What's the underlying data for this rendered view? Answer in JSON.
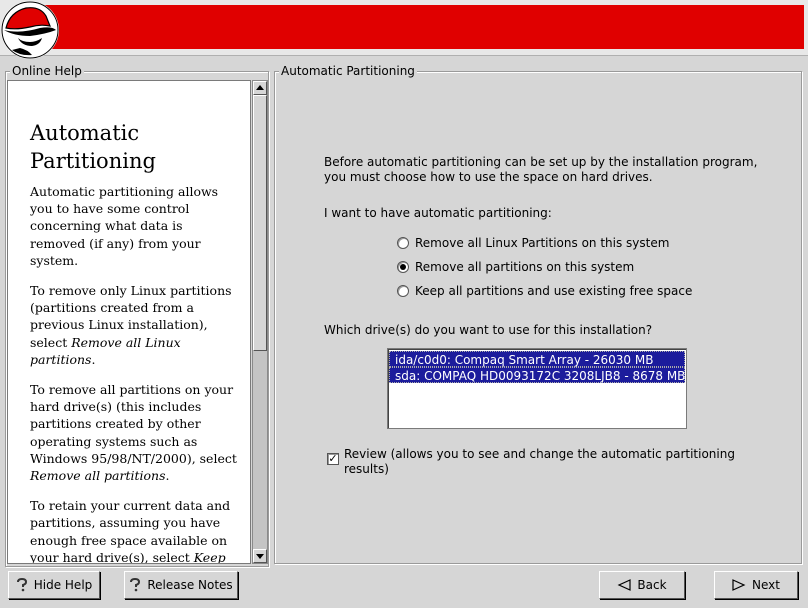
{
  "help_panel": {
    "title": "Online Help",
    "heading": "Automatic Partitioning",
    "paragraphs": [
      {
        "text": "Automatic partitioning allows you to have some control concerning what data is removed (if any) from your system.",
        "em": ""
      },
      {
        "text": "To remove only Linux partitions (partitions created from a previous Linux installation), select ",
        "em": "Remove all Linux partitions",
        "tail": "."
      },
      {
        "text": "To remove all partitions on your hard drive(s) (this includes partitions created by other operating systems such as Windows 95/98/NT/2000), select ",
        "em": "Remove all partitions",
        "tail": "."
      },
      {
        "text": "To retain your current data and partitions, assuming you have enough free space available on your hard drive(s), select ",
        "em": "Keep all partitions and use existing free space",
        "tail": "."
      }
    ]
  },
  "main": {
    "title": "Automatic Partitioning",
    "intro_line1": "Before automatic partitioning can be set up by the installation program,",
    "intro_line2": "you must choose how to use the space on hard drives.",
    "want_label": "I want to have automatic partitioning:",
    "options": [
      {
        "label": "Remove all Linux Partitions on this system",
        "checked": false
      },
      {
        "label": "Remove all partitions on this system",
        "checked": true
      },
      {
        "label": "Keep all partitions and use existing free space",
        "checked": false
      }
    ],
    "drives_label": "Which drive(s) do you want to use for this installation?",
    "drives": [
      "ida/c0d0: Compaq Smart Array - 26030 MB",
      "sda: COMPAQ HD0093172C 3208LJB8 - 8678 MB"
    ],
    "review_line1": "Review (allows you to see and change the automatic partitioning",
    "review_line2": "results)",
    "review_checked": true
  },
  "buttons": {
    "hide_help": "Hide Help",
    "release_notes": "Release Notes",
    "back": "Back",
    "next": "Next"
  },
  "colors": {
    "banner_red": "#e00000",
    "selection": "#1c1c9c"
  }
}
